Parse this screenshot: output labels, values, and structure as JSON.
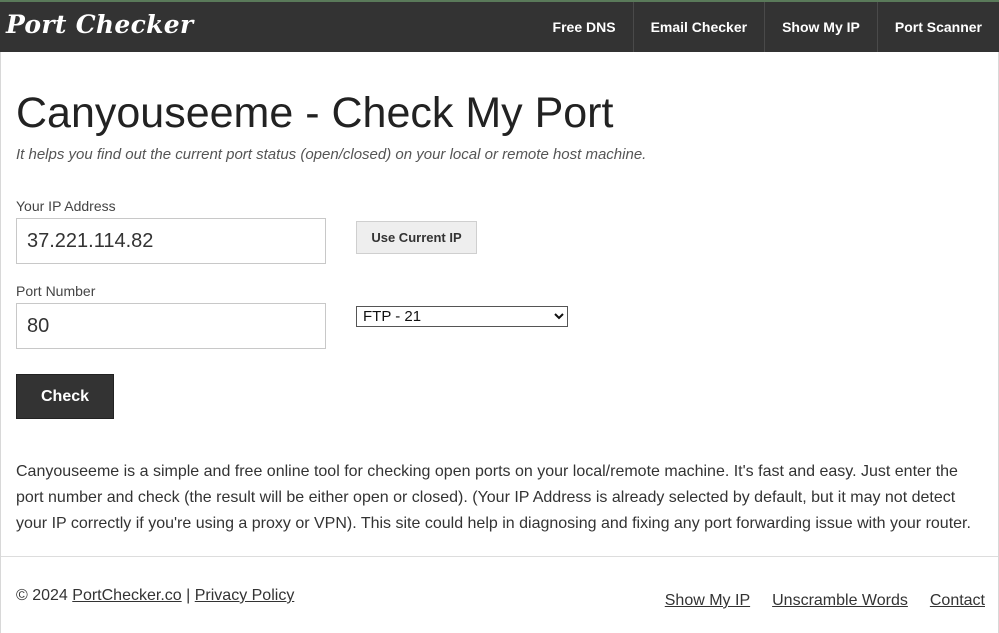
{
  "header": {
    "logo": "Port Checker",
    "nav": [
      "Free DNS",
      "Email Checker",
      "Show My IP",
      "Port Scanner"
    ]
  },
  "main": {
    "title": "Canyouseeme - Check My Port",
    "subtitle": "It helps you find out the current port status (open/closed) on your local or remote host machine.",
    "ip_label": "Your IP Address",
    "ip_value": "37.221.114.82",
    "use_current_ip_label": "Use Current IP",
    "port_label": "Port Number",
    "port_value": "80",
    "port_select_selected": "FTP - 21",
    "check_label": "Check",
    "description": "Canyouseeme is a simple and free online tool for checking open ports on your local/remote machine. It's fast and easy. Just enter the port number and check (the result will be either open or closed). (Your IP Address is already selected by default, but it may not detect your IP correctly if you're using a proxy or VPN). This site could help in diagnosing and fixing any port forwarding issue with your router."
  },
  "footer": {
    "copyright": "© 2024",
    "site_link": "PortChecker.co",
    "separator": "|",
    "privacy_link": "Privacy Policy",
    "links": [
      "Show My IP",
      "Unscramble Words",
      "Contact"
    ]
  },
  "colors": {
    "header_bg": "#333333",
    "button_dark": "#333333",
    "text": "#222222"
  }
}
